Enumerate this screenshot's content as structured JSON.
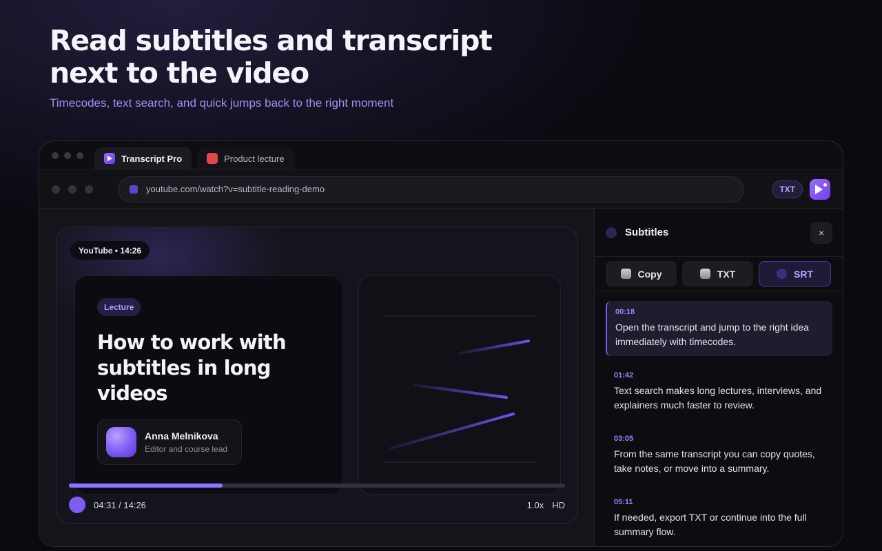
{
  "hero": {
    "title": "Read subtitles and transcript next to the video",
    "subtitle": "Timecodes, text search, and quick jumps back to the right moment"
  },
  "browser": {
    "tabs": [
      {
        "label": "Transcript Pro",
        "icon": "transcript-pro-icon"
      },
      {
        "label": "Product lecture",
        "icon": "youtube-icon"
      }
    ],
    "url": "youtube.com/watch?v=subtitle-reading-demo",
    "txt_badge": "TXT"
  },
  "player": {
    "badge": "YouTube • 14:26",
    "tag": "Lecture",
    "title": "How to work with subtitles in long videos",
    "author_name": "Anna Melnikova",
    "author_role": "Editor and course lead",
    "time": "04:31 / 14:26",
    "progress": 0.31,
    "speed": "1.0x",
    "quality": "HD"
  },
  "sidebar": {
    "title": "Subtitles",
    "close": "×",
    "actions": {
      "copy": "Copy",
      "txt": "TXT",
      "srt": "SRT"
    },
    "cues": [
      {
        "time": "00:18",
        "text": "Open the transcript and jump to the right idea immediately with timecodes."
      },
      {
        "time": "01:42",
        "text": "Text search makes long lectures, interviews, and explainers much faster to review."
      },
      {
        "time": "03:05",
        "text": "From the same transcript you can copy quotes, take notes, or move into a summary."
      },
      {
        "time": "05:11",
        "text": "If needed, export TXT or continue into the full summary flow."
      }
    ]
  },
  "colors": {
    "accent": "#8f72ff",
    "background": "#0b0a10"
  }
}
